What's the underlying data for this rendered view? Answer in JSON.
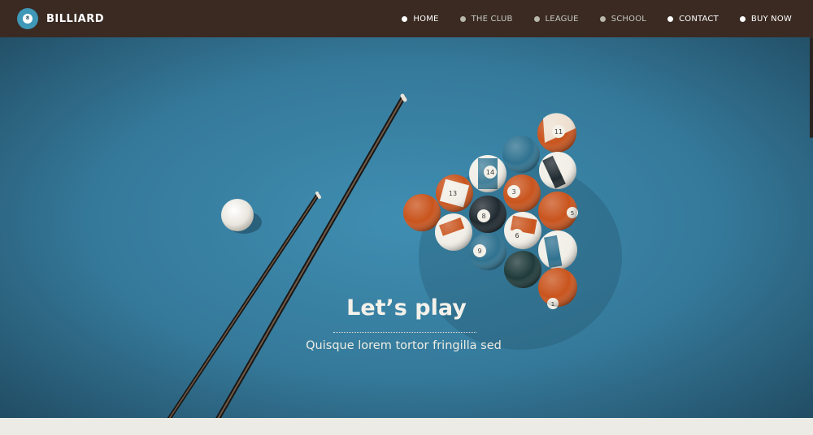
{
  "header": {
    "logo_text": "BILLIARD",
    "logo_icon": "8-ball-icon",
    "logo_badge_text": "8"
  },
  "nav": {
    "items": [
      {
        "label": "HOME",
        "active": true
      },
      {
        "label": "THE CLUB",
        "active": false
      },
      {
        "label": "LEAGUE",
        "active": false
      },
      {
        "label": "SCHOOL",
        "active": false
      },
      {
        "label": "CONTACT",
        "active": true
      },
      {
        "label": "BUY NOW",
        "active": true
      }
    ]
  },
  "hero": {
    "title": "Let’s play",
    "subtitle": "Quisque lorem tortor fringilla sed",
    "balls": [
      "11",
      "14",
      "13",
      "3",
      "8",
      "5",
      "9",
      "6",
      "1"
    ]
  },
  "colors": {
    "header_bg": "#3a2a22",
    "table_felt": "#3f8eb2",
    "ball_orange": "#c9541d",
    "ball_teal": "#2f7290",
    "ball_black": "#1f2a30"
  }
}
